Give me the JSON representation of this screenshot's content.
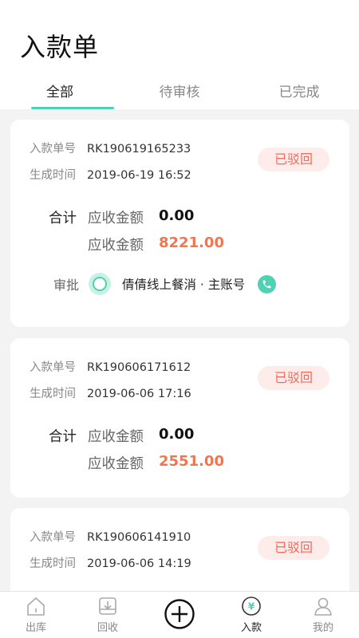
{
  "header": {
    "title": "入款单"
  },
  "tabs": [
    {
      "label": "全部"
    },
    {
      "label": "待审核"
    },
    {
      "label": "已完成"
    }
  ],
  "labels": {
    "order_no": "入款单号",
    "created_at": "生成时间",
    "total": "合计",
    "amount_receivable": "应收金额",
    "approve": "审批"
  },
  "records": [
    {
      "order_no": "RK190619165233",
      "created_at": "2019-06-19 16:52",
      "status": "已驳回",
      "amount_1": "0.00",
      "amount_2": "8221.00",
      "approver": "倩倩线上餐消 · 主账号"
    },
    {
      "order_no": "RK190606171612",
      "created_at": "2019-06-06 17:16",
      "status": "已驳回",
      "amount_1": "0.00",
      "amount_2": "2551.00"
    },
    {
      "order_no": "RK190606141910",
      "created_at": "2019-06-06 14:19",
      "status": "已驳回"
    }
  ],
  "nav": [
    {
      "label": "出库",
      "icon": "house-icon"
    },
    {
      "label": "回收",
      "icon": "recycle-box-icon"
    },
    {
      "label": "",
      "icon": "plus-circle-icon"
    },
    {
      "label": "入款",
      "icon": "yen-icon"
    },
    {
      "label": "我的",
      "icon": "user-icon"
    }
  ],
  "colors": {
    "accent": "#4fd1b4",
    "status_red": "#f26a5b",
    "amount_orange": "#f0764f"
  }
}
